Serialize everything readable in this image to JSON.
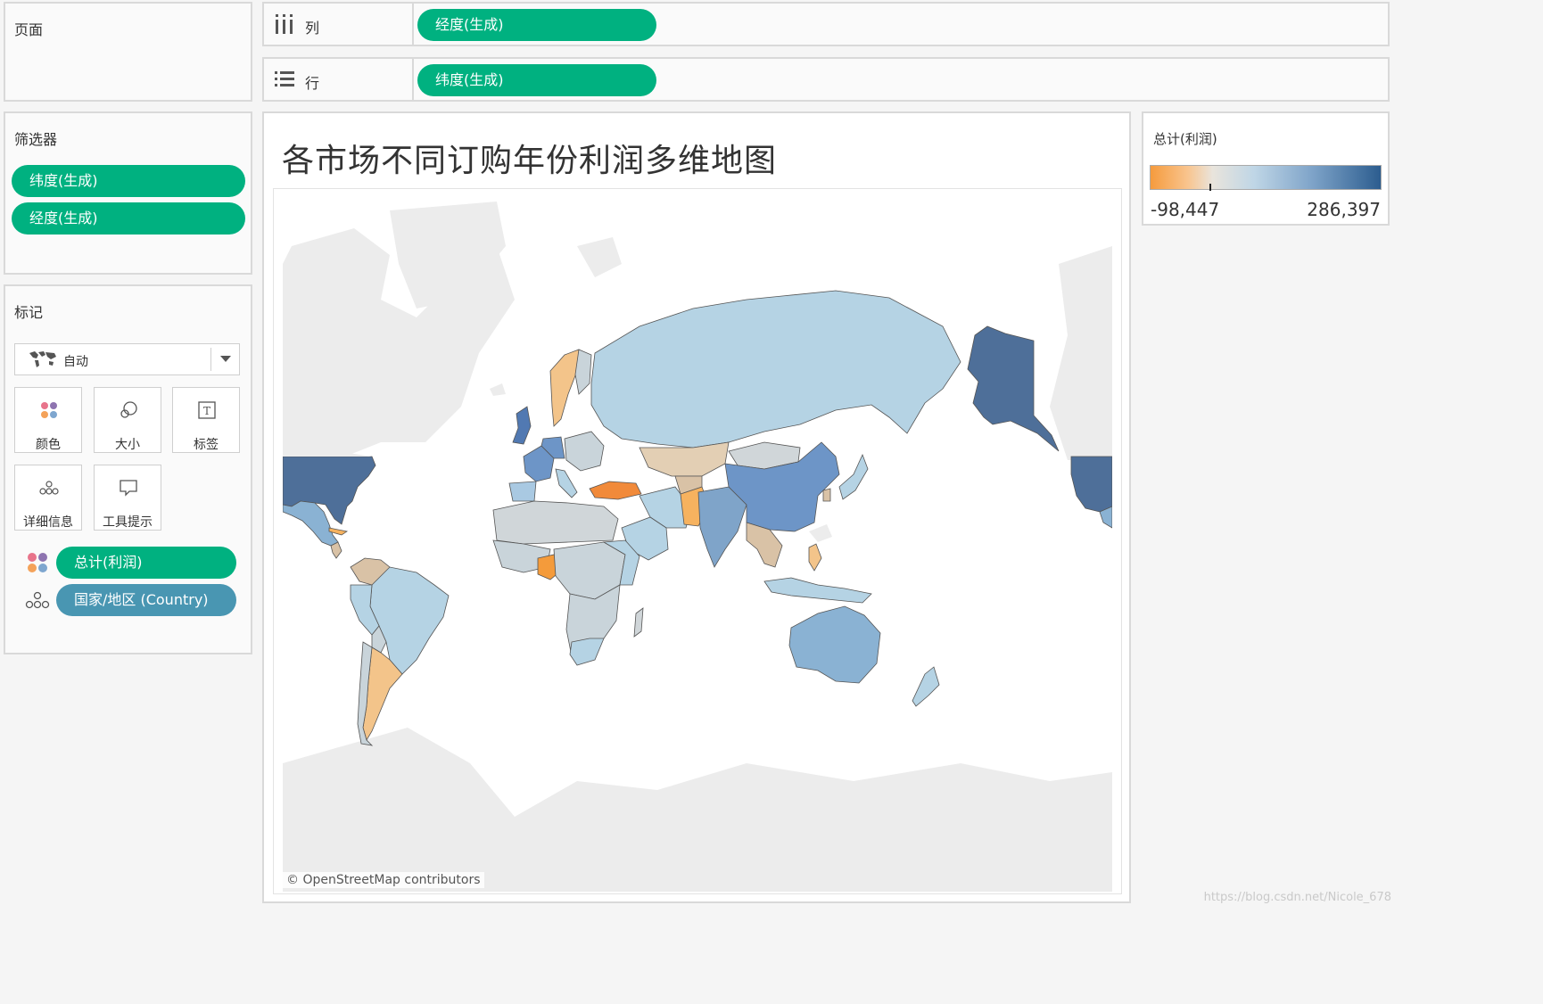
{
  "pages_panel": {
    "title": "页面"
  },
  "columns_shelf": {
    "label": "列",
    "pill": "经度(生成)"
  },
  "rows_shelf": {
    "label": "行",
    "pill": "纬度(生成)"
  },
  "filters_panel": {
    "title": "筛选器",
    "pills": [
      "纬度(生成)",
      "经度(生成)"
    ]
  },
  "marks_panel": {
    "title": "标记",
    "mark_type": "自动",
    "buttons": [
      "颜色",
      "大小",
      "标签",
      "详细信息",
      "工具提示"
    ],
    "fields": [
      {
        "label": "总计(利润)",
        "encoding": "color"
      },
      {
        "label": "国家/地区 (Country)",
        "encoding": "detail"
      }
    ]
  },
  "viz": {
    "title": "各市场不同订购年份利润多维地图",
    "map_credit": "© OpenStreetMap contributors"
  },
  "legend": {
    "title": "总计(利润)",
    "min": "-98,447",
    "max": "286,397",
    "color_low": "#f59b3d",
    "color_mid": "#bfd6e6",
    "color_high": "#2c5d8f"
  },
  "colors": {
    "pill_green": "#00b180",
    "pill_blue": "#4996b2"
  },
  "watermark": "https://blog.csdn.net/Nicole_678"
}
